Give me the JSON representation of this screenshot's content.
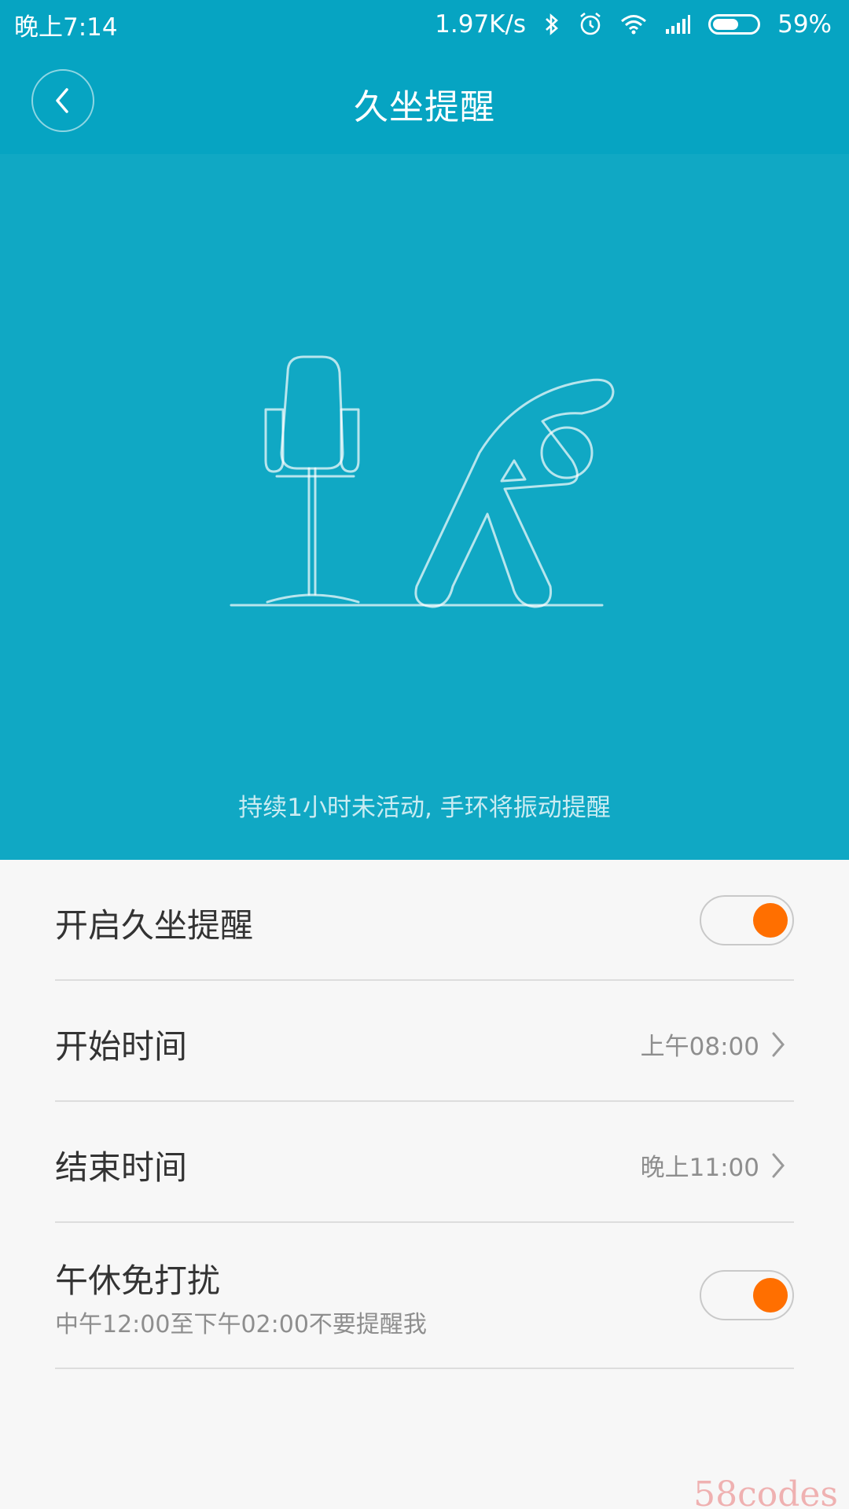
{
  "status_bar": {
    "time": "晚上7:14",
    "speed": "1.97K/s",
    "battery": "59%",
    "icons": [
      "bluetooth-icon",
      "alarm-icon",
      "wifi-icon",
      "signal-icon",
      "battery-icon"
    ]
  },
  "header": {
    "title": "久坐提醒",
    "back_icon": "chevron-left-icon"
  },
  "hero": {
    "illustration": "chair-and-stretching-person",
    "caption": "持续1小时未活动, 手环将振动提醒"
  },
  "settings": {
    "enable": {
      "label": "开启久坐提醒",
      "on": true
    },
    "start_time": {
      "label": "开始时间",
      "value": "上午08:00"
    },
    "end_time": {
      "label": "结束时间",
      "value": "晚上11:00"
    },
    "nap": {
      "label": "午休免打扰",
      "description": "中午12:00至下午02:00不要提醒我",
      "on": true
    }
  },
  "watermark": "58codes",
  "colors": {
    "header_bg": "#06a4c2",
    "hero_bg": "#10a8c4",
    "toggle_on": "#ff6f00",
    "background": "#f7f7f7"
  }
}
